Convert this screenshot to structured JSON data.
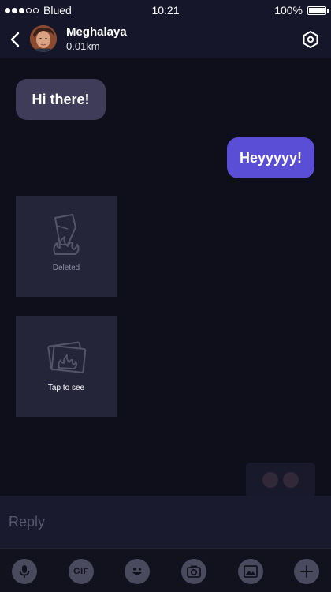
{
  "status_bar": {
    "carrier": "Blued",
    "time": "10:21",
    "battery": "100%",
    "signal_bars_filled": 3,
    "signal_bars_total": 5
  },
  "header": {
    "contact_name": "Meghalaya",
    "distance": "0.01km",
    "back_icon": "chevron-left-icon",
    "settings_icon": "hexagon-settings-icon"
  },
  "messages": {
    "incoming_text": "Hi there!",
    "outgoing_text": "Heyyyyy!",
    "deleted_label": "Deleted",
    "tap_label": "Tap to see"
  },
  "reply": {
    "placeholder": "Reply"
  },
  "toolbar": {
    "gif_label": "GIF",
    "icons": [
      "microphone-icon",
      "gif-icon",
      "emoji-icon",
      "camera-icon",
      "image-icon",
      "plus-icon"
    ]
  },
  "colors": {
    "background": "#0f0f1c",
    "incoming_bubble": "#3e3c58",
    "outgoing_bubble": "#5b4ed6",
    "card": "#25253a",
    "toolbar_icon": "#4a4a5e"
  }
}
